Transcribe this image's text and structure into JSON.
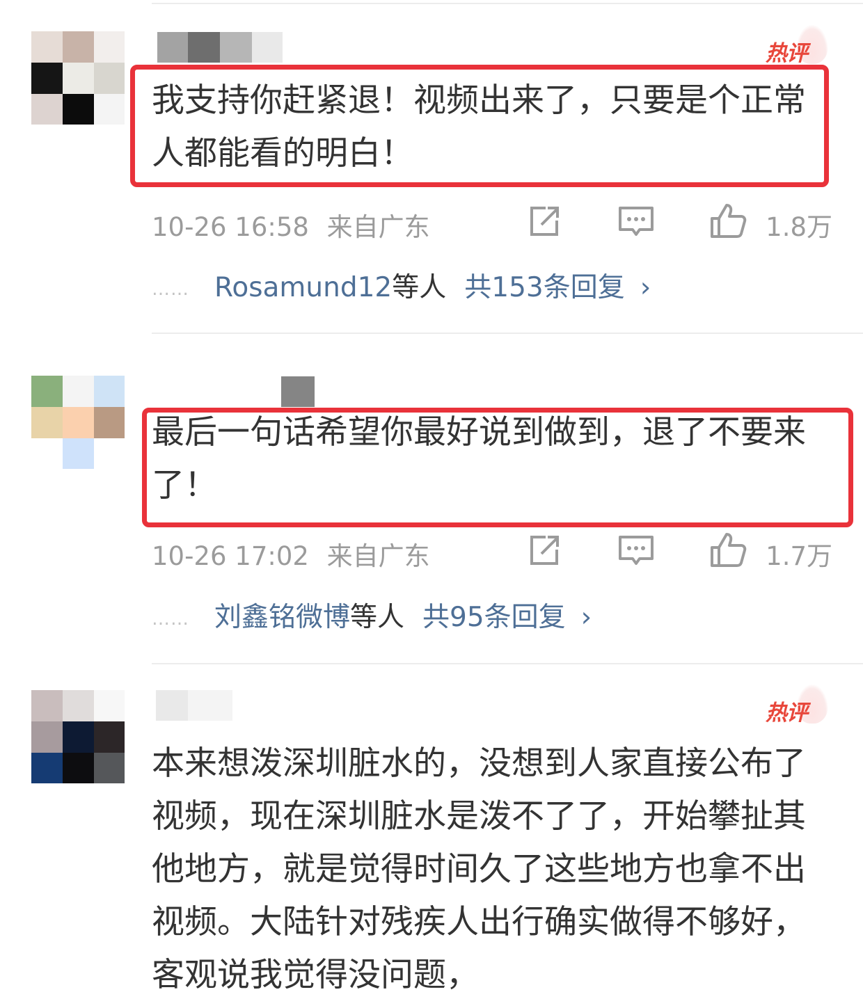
{
  "comments": [
    {
      "badge": "热评",
      "text": "我支持你赶紧退！视频出来了，只要是个正常人都能看的明白！",
      "time": "10-26 16:58",
      "location": "来自广东",
      "likes": "1.8万",
      "reply_users": "Rosamund12",
      "reply_etc": "等人",
      "reply_count": "共153条回复",
      "reply_chevron": "›"
    },
    {
      "text": "最后一句话希望你最好说到做到，退了不要来了！",
      "time": "10-26 17:02",
      "location": "来自广东",
      "likes": "1.7万",
      "reply_users": "刘鑫铭微博",
      "reply_etc": "等人",
      "reply_count": "共95条回复",
      "reply_chevron": "›"
    },
    {
      "badge": "热评",
      "text": "本来想泼深圳脏水的，没想到人家直接公布了视频，现在深圳脏水是泼不了了，开始攀扯其他地方，就是觉得时间久了这些地方也拿不出视频。大陆针对残疾人出行确实做得不够好，客观说我觉得没问题，"
    }
  ],
  "icons": {
    "repost": "share-icon",
    "comment": "comment-icon",
    "like": "thumbs-up-icon",
    "reply_dots": "ellipsis-icon"
  },
  "colors": {
    "highlight_box": "#e9323a",
    "badge": "#e8473b",
    "link": "#4e6f96",
    "meta": "#9b9b9b",
    "body": "#333333"
  }
}
